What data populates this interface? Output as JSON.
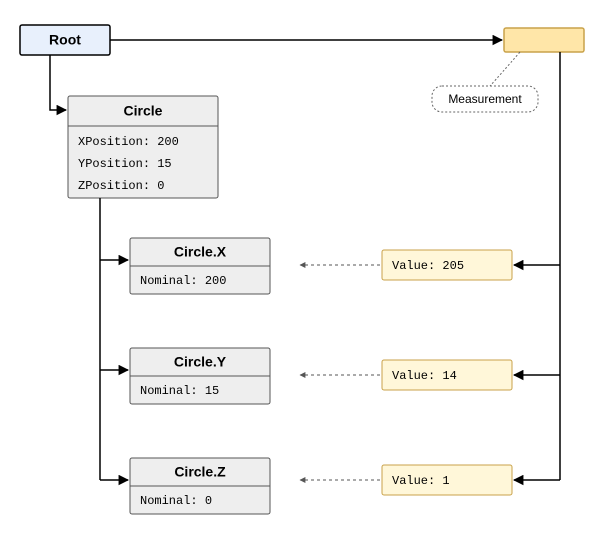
{
  "root": {
    "label": "Root"
  },
  "measurement_callout": {
    "label": "Measurement"
  },
  "circle": {
    "title": "Circle",
    "props": {
      "x": {
        "label": "XPosition",
        "value": "200"
      },
      "y": {
        "label": "YPosition",
        "value": "15"
      },
      "z": {
        "label": "ZPosition",
        "value": "0"
      }
    }
  },
  "axes": [
    {
      "title": "Circle.X",
      "nominal_label": "Nominal",
      "nominal_value": "200",
      "value_label": "Value",
      "value": "205"
    },
    {
      "title": "Circle.Y",
      "nominal_label": "Nominal",
      "nominal_value": "15",
      "value_label": "Value",
      "value": "14"
    },
    {
      "title": "Circle.Z",
      "nominal_label": "Nominal",
      "nominal_value": "0",
      "value_label": "Value",
      "value": "1"
    }
  ]
}
